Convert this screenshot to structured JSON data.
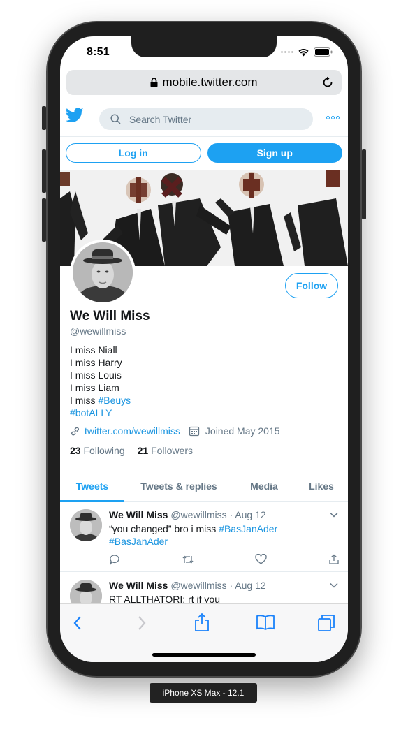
{
  "status_bar": {
    "time": "8:51"
  },
  "address_bar": {
    "url": "mobile.twitter.com"
  },
  "header": {
    "search_placeholder": "Search Twitter"
  },
  "auth": {
    "login_label": "Log in",
    "signup_label": "Sign up"
  },
  "profile": {
    "name": "We Will Miss",
    "handle": "@wewillmiss",
    "follow_label": "Follow",
    "bio_lines": [
      "I miss Niall",
      "I miss Harry",
      "I miss Louis",
      "I miss Liam"
    ],
    "bio_last_prefix": "I miss ",
    "bio_hashtag_1": "#Beuys",
    "bio_hashtag_2": "#botALLY",
    "website": "twitter.com/wewillmiss",
    "joined": "Joined May 2015",
    "following_count": "23",
    "following_label": "Following",
    "followers_count": "21",
    "followers_label": "Followers"
  },
  "tabs": [
    {
      "label": "Tweets",
      "active": true
    },
    {
      "label": "Tweets & replies",
      "active": false
    },
    {
      "label": "Media",
      "active": false
    },
    {
      "label": "Likes",
      "active": false
    }
  ],
  "tweets": [
    {
      "name": "We Will Miss",
      "handle": "@wewillmiss",
      "date": "· Aug 12",
      "text_prefix": "“you changed” bro i miss ",
      "hashtag_1": "#BasJanAder",
      "hashtag_2": "#BasJanAder"
    },
    {
      "name": "We Will Miss",
      "handle": "@wewillmiss",
      "date": "· Aug 12",
      "text_prefix": "RT ALLTHATORI: rt if you"
    }
  ],
  "device_label": "iPhone XS Max - 12.1",
  "colors": {
    "twitter_blue": "#1da1f2",
    "link_blue": "#1b95e0",
    "muted_gray": "#657786"
  }
}
